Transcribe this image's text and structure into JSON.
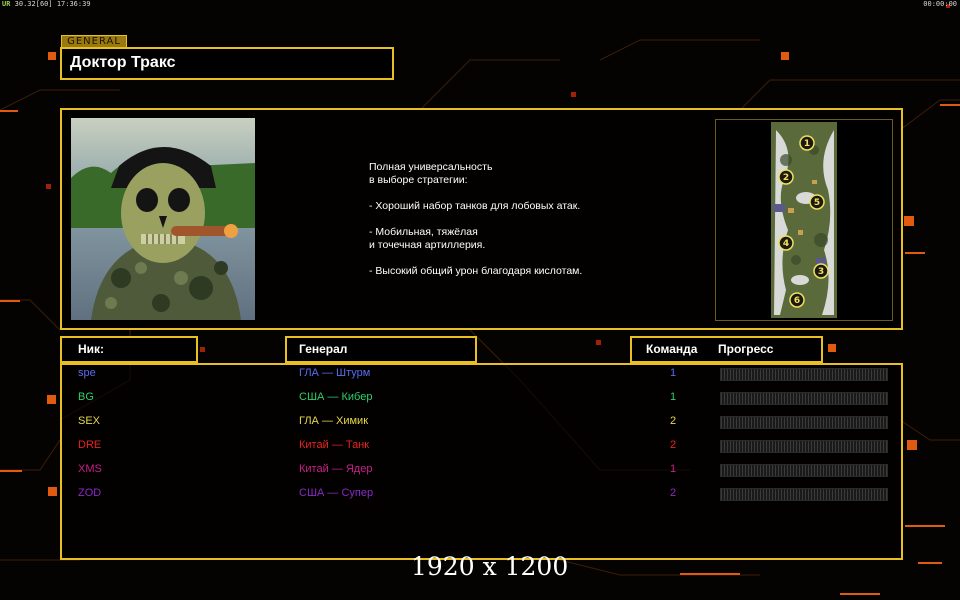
{
  "hud": {
    "fps_tag": "UR",
    "fps_values": "30.32[60]",
    "clock": "17:36:39",
    "timer": "00:00:00"
  },
  "general_tag": "GENERAL",
  "general_name": "Доктор Тракс",
  "description": "Полная универсальность\nв выборе стратегии:\n\n- Хороший набор танков для лобовых атак.\n\n- Мобильная, тяжёлая\nи точечная артиллерия.\n\n- Высокий общий урон благодаря кислотам.",
  "columns": {
    "nick": "Ник:",
    "general": "Генерал",
    "team": "Команда",
    "progress": "Прогресс"
  },
  "players": [
    {
      "nick": "spe",
      "general": "ГЛА — Штурм",
      "team": "1",
      "color": "#5a6cf0",
      "progress": 0
    },
    {
      "nick": "BG",
      "general": "США — Кибер",
      "team": "1",
      "color": "#2fd06a",
      "progress": 0
    },
    {
      "nick": "SEX",
      "general": "ГЛА — Химик",
      "team": "2",
      "color": "#e6d94a",
      "progress": 0
    },
    {
      "nick": "DRE",
      "general": "Китай — Танк",
      "team": "2",
      "color": "#e8231e",
      "progress": 0
    },
    {
      "nick": "XMS",
      "general": "Китай — Ядер",
      "team": "1",
      "color": "#c8208a",
      "progress": 0
    },
    {
      "nick": "ZOD",
      "general": "США — Супер",
      "team": "2",
      "color": "#8a2ac8",
      "progress": 0
    }
  ],
  "map_spots": [
    "1",
    "2",
    "5",
    "4",
    "3",
    "6"
  ],
  "resolution_label": "1920 x 1200",
  "colors": {
    "accent": "#e8c020",
    "orange": "#e06010"
  }
}
